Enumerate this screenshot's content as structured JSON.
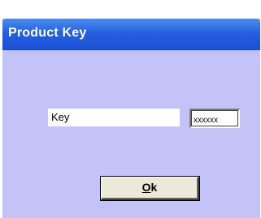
{
  "window": {
    "title": "Product Key"
  },
  "form": {
    "key_label": "Key",
    "key_value": "xxxxxx"
  },
  "buttons": {
    "ok_mnemonic": "O",
    "ok_rest": "k"
  },
  "colors": {
    "titlebar": "#2460e0",
    "window_background": "#c3c3f7",
    "button_face": "#ece9d8"
  }
}
